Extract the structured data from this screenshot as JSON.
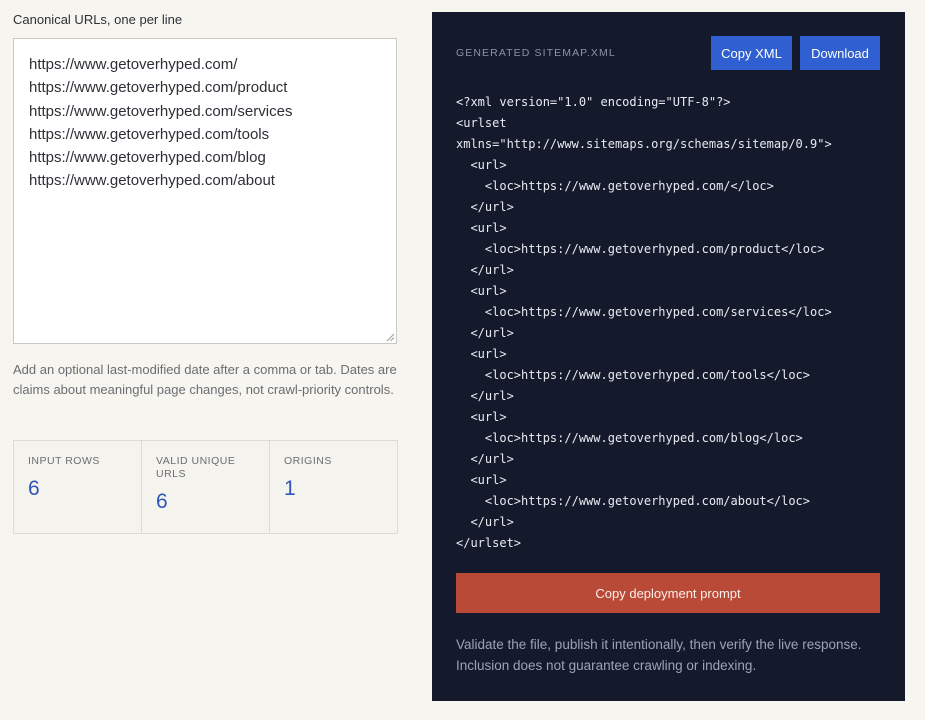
{
  "input": {
    "label": "Canonical URLs, one per line",
    "urls": [
      "https://www.getoverhyped.com/",
      "https://www.getoverhyped.com/product",
      "https://www.getoverhyped.com/services",
      "https://www.getoverhyped.com/tools",
      "https://www.getoverhyped.com/blog",
      "https://www.getoverhyped.com/about"
    ],
    "hint": "Add an optional last-modified date after a comma or tab. Dates are claims about meaningful page changes, not crawl-priority controls."
  },
  "stats": [
    {
      "label": "INPUT ROWS",
      "value": "6"
    },
    {
      "label": "VALID UNIQUE URLS",
      "value": "6"
    },
    {
      "label": "ORIGINS",
      "value": "1"
    }
  ],
  "output": {
    "title": "GENERATED SITEMAP.XML",
    "copy_label": "Copy XML",
    "download_label": "Download",
    "xml_lines": [
      "<?xml version=\"1.0\" encoding=\"UTF-8\"?>",
      "<urlset",
      "xmlns=\"http://www.sitemaps.org/schemas/sitemap/0.9\">",
      "  <url>",
      "    <loc>https://www.getoverhyped.com/</loc>",
      "  </url>",
      "  <url>",
      "    <loc>https://www.getoverhyped.com/product</loc>",
      "  </url>",
      "  <url>",
      "    <loc>https://www.getoverhyped.com/services</loc>",
      "  </url>",
      "  <url>",
      "    <loc>https://www.getoverhyped.com/tools</loc>",
      "  </url>",
      "  <url>",
      "    <loc>https://www.getoverhyped.com/blog</loc>",
      "  </url>",
      "  <url>",
      "    <loc>https://www.getoverhyped.com/about</loc>",
      "  </url>",
      "</urlset>"
    ],
    "deploy_label": "Copy deployment prompt",
    "note": "Validate the file, publish it intentionally, then verify the live response. Inclusion does not guarantee crawling or indexing."
  },
  "colors": {
    "panel_bg": "#141a2b",
    "primary_button": "#2f5fd0",
    "deploy_button": "#b94a38",
    "stat_value": "#2f55b8"
  }
}
